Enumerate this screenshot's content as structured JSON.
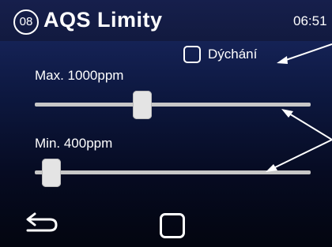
{
  "header": {
    "screen_number": "08",
    "title": "AQS Limity",
    "time": "06:51"
  },
  "breathing": {
    "label": "Dýchání",
    "checked": false
  },
  "max_slider": {
    "label": "Max. 1000ppm",
    "position_fraction": 0.39
  },
  "min_slider": {
    "label": "Min. 400ppm",
    "position_fraction": 0.06
  },
  "footer": {
    "back_icon": "back-arrow-icon",
    "home_icon": "square-button-icon"
  },
  "colors": {
    "background_top": "#1b2a66",
    "background_bottom": "#03050f",
    "text": "#ffffff",
    "slider_track": "#c7c7c7",
    "slider_thumb": "#e4e4e4"
  }
}
